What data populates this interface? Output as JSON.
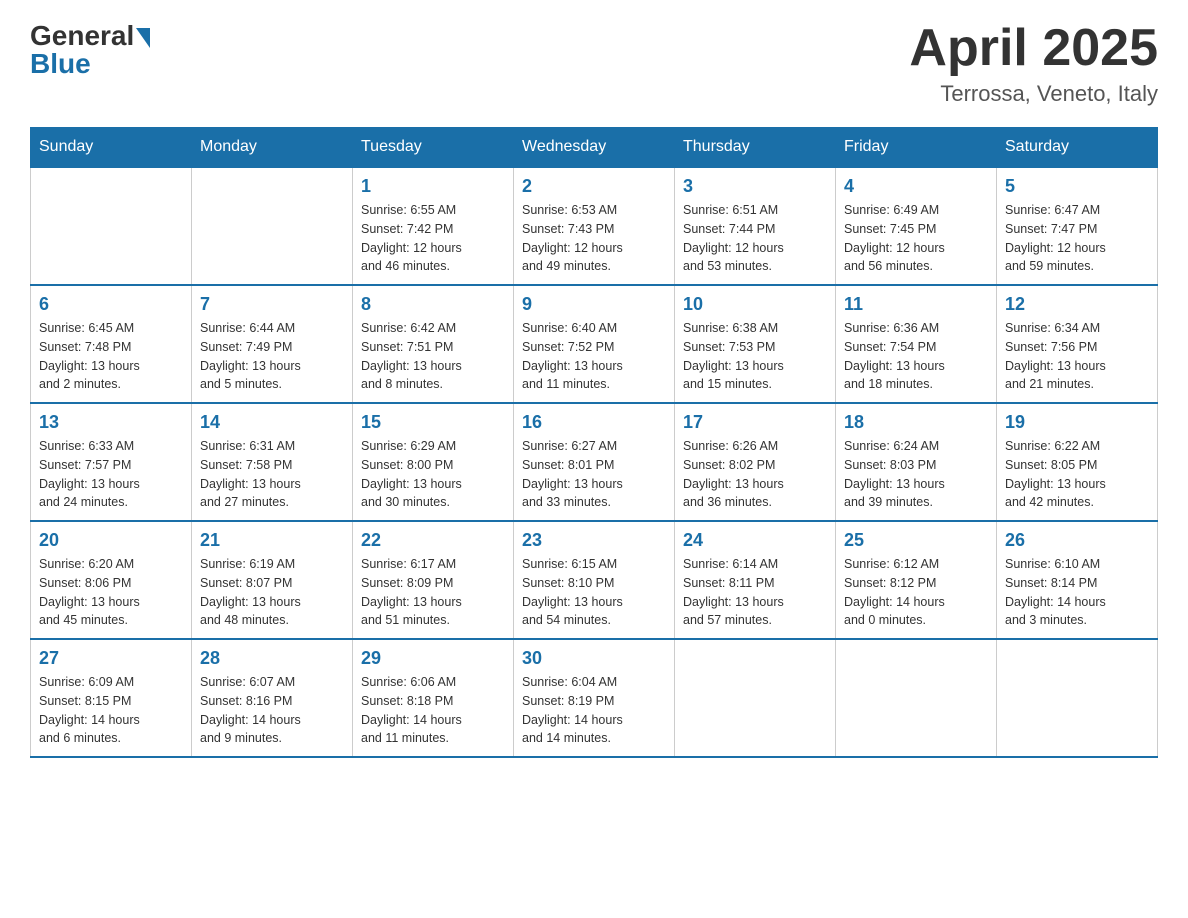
{
  "header": {
    "logo": {
      "general": "General",
      "blue": "Blue",
      "line2": "Blue"
    },
    "title": "April 2025",
    "location": "Terrossa, Veneto, Italy"
  },
  "calendar": {
    "days_of_week": [
      "Sunday",
      "Monday",
      "Tuesday",
      "Wednesday",
      "Thursday",
      "Friday",
      "Saturday"
    ],
    "weeks": [
      [
        {
          "day": "",
          "info": ""
        },
        {
          "day": "",
          "info": ""
        },
        {
          "day": "1",
          "info": "Sunrise: 6:55 AM\nSunset: 7:42 PM\nDaylight: 12 hours\nand 46 minutes."
        },
        {
          "day": "2",
          "info": "Sunrise: 6:53 AM\nSunset: 7:43 PM\nDaylight: 12 hours\nand 49 minutes."
        },
        {
          "day": "3",
          "info": "Sunrise: 6:51 AM\nSunset: 7:44 PM\nDaylight: 12 hours\nand 53 minutes."
        },
        {
          "day": "4",
          "info": "Sunrise: 6:49 AM\nSunset: 7:45 PM\nDaylight: 12 hours\nand 56 minutes."
        },
        {
          "day": "5",
          "info": "Sunrise: 6:47 AM\nSunset: 7:47 PM\nDaylight: 12 hours\nand 59 minutes."
        }
      ],
      [
        {
          "day": "6",
          "info": "Sunrise: 6:45 AM\nSunset: 7:48 PM\nDaylight: 13 hours\nand 2 minutes."
        },
        {
          "day": "7",
          "info": "Sunrise: 6:44 AM\nSunset: 7:49 PM\nDaylight: 13 hours\nand 5 minutes."
        },
        {
          "day": "8",
          "info": "Sunrise: 6:42 AM\nSunset: 7:51 PM\nDaylight: 13 hours\nand 8 minutes."
        },
        {
          "day": "9",
          "info": "Sunrise: 6:40 AM\nSunset: 7:52 PM\nDaylight: 13 hours\nand 11 minutes."
        },
        {
          "day": "10",
          "info": "Sunrise: 6:38 AM\nSunset: 7:53 PM\nDaylight: 13 hours\nand 15 minutes."
        },
        {
          "day": "11",
          "info": "Sunrise: 6:36 AM\nSunset: 7:54 PM\nDaylight: 13 hours\nand 18 minutes."
        },
        {
          "day": "12",
          "info": "Sunrise: 6:34 AM\nSunset: 7:56 PM\nDaylight: 13 hours\nand 21 minutes."
        }
      ],
      [
        {
          "day": "13",
          "info": "Sunrise: 6:33 AM\nSunset: 7:57 PM\nDaylight: 13 hours\nand 24 minutes."
        },
        {
          "day": "14",
          "info": "Sunrise: 6:31 AM\nSunset: 7:58 PM\nDaylight: 13 hours\nand 27 minutes."
        },
        {
          "day": "15",
          "info": "Sunrise: 6:29 AM\nSunset: 8:00 PM\nDaylight: 13 hours\nand 30 minutes."
        },
        {
          "day": "16",
          "info": "Sunrise: 6:27 AM\nSunset: 8:01 PM\nDaylight: 13 hours\nand 33 minutes."
        },
        {
          "day": "17",
          "info": "Sunrise: 6:26 AM\nSunset: 8:02 PM\nDaylight: 13 hours\nand 36 minutes."
        },
        {
          "day": "18",
          "info": "Sunrise: 6:24 AM\nSunset: 8:03 PM\nDaylight: 13 hours\nand 39 minutes."
        },
        {
          "day": "19",
          "info": "Sunrise: 6:22 AM\nSunset: 8:05 PM\nDaylight: 13 hours\nand 42 minutes."
        }
      ],
      [
        {
          "day": "20",
          "info": "Sunrise: 6:20 AM\nSunset: 8:06 PM\nDaylight: 13 hours\nand 45 minutes."
        },
        {
          "day": "21",
          "info": "Sunrise: 6:19 AM\nSunset: 8:07 PM\nDaylight: 13 hours\nand 48 minutes."
        },
        {
          "day": "22",
          "info": "Sunrise: 6:17 AM\nSunset: 8:09 PM\nDaylight: 13 hours\nand 51 minutes."
        },
        {
          "day": "23",
          "info": "Sunrise: 6:15 AM\nSunset: 8:10 PM\nDaylight: 13 hours\nand 54 minutes."
        },
        {
          "day": "24",
          "info": "Sunrise: 6:14 AM\nSunset: 8:11 PM\nDaylight: 13 hours\nand 57 minutes."
        },
        {
          "day": "25",
          "info": "Sunrise: 6:12 AM\nSunset: 8:12 PM\nDaylight: 14 hours\nand 0 minutes."
        },
        {
          "day": "26",
          "info": "Sunrise: 6:10 AM\nSunset: 8:14 PM\nDaylight: 14 hours\nand 3 minutes."
        }
      ],
      [
        {
          "day": "27",
          "info": "Sunrise: 6:09 AM\nSunset: 8:15 PM\nDaylight: 14 hours\nand 6 minutes."
        },
        {
          "day": "28",
          "info": "Sunrise: 6:07 AM\nSunset: 8:16 PM\nDaylight: 14 hours\nand 9 minutes."
        },
        {
          "day": "29",
          "info": "Sunrise: 6:06 AM\nSunset: 8:18 PM\nDaylight: 14 hours\nand 11 minutes."
        },
        {
          "day": "30",
          "info": "Sunrise: 6:04 AM\nSunset: 8:19 PM\nDaylight: 14 hours\nand 14 minutes."
        },
        {
          "day": "",
          "info": ""
        },
        {
          "day": "",
          "info": ""
        },
        {
          "day": "",
          "info": ""
        }
      ]
    ]
  }
}
